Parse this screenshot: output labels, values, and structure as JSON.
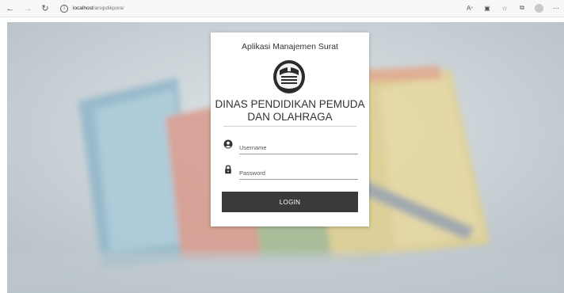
{
  "browser": {
    "url_host": "localhost",
    "url_path": "/arsipdikpora/",
    "icons": [
      "back-icon",
      "forward-icon",
      "refresh-icon",
      "info-icon",
      "read-aloud-icon",
      "tab-icon",
      "favorites-icon",
      "collections-icon",
      "profile-icon",
      "more-icon"
    ]
  },
  "login": {
    "app_title": "Aplikasi Manajemen Surat",
    "org_name_line1": "DINAS PENDIDIKAN PEMUDA",
    "org_name_line2": "DAN OLAHRAGA",
    "username_placeholder": "Username",
    "password_placeholder": "Password",
    "login_label": "LOGIN"
  },
  "colors": {
    "button_bg": "#3a3a3a",
    "page_bg": "#c7d0d5"
  }
}
